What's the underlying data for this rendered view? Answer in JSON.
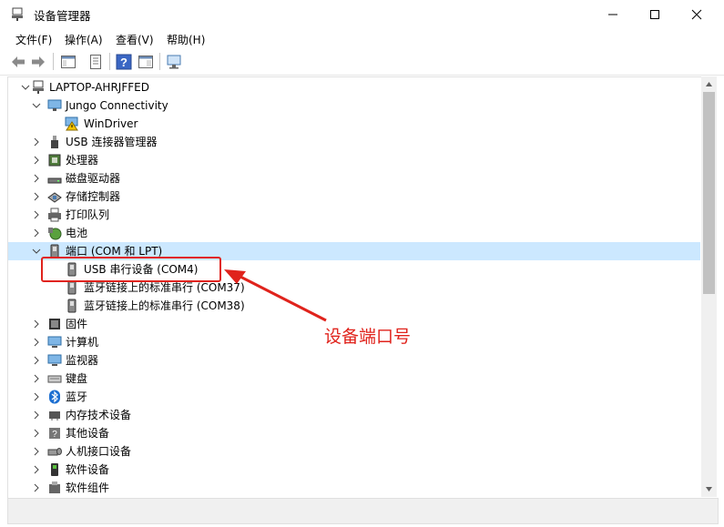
{
  "window": {
    "title": "设备管理器"
  },
  "menu": [
    "文件(F)",
    "操作(A)",
    "查看(V)",
    "帮助(H)"
  ],
  "toolbar": [
    "back-icon",
    "forward-icon",
    "show-hide-tree-icon",
    "properties-icon",
    "help-icon",
    "action-pane-icon",
    "scan-hardware-icon"
  ],
  "tree": {
    "root": "LAPTOP-AHRJFFED",
    "items": [
      {
        "label": "Jungo Connectivity",
        "expanded": true,
        "children": [
          {
            "label": "WinDriver"
          }
        ]
      },
      {
        "label": "USB 连接器管理器"
      },
      {
        "label": "处理器"
      },
      {
        "label": "磁盘驱动器"
      },
      {
        "label": "存储控制器"
      },
      {
        "label": "打印队列"
      },
      {
        "label": "电池"
      },
      {
        "label": "端口 (COM 和 LPT)",
        "expanded": true,
        "children": [
          {
            "label": "USB 串行设备 (COM4)"
          },
          {
            "label": "蓝牙链接上的标准串行 (COM37)"
          },
          {
            "label": "蓝牙链接上的标准串行 (COM38)"
          }
        ]
      },
      {
        "label": "固件"
      },
      {
        "label": "计算机"
      },
      {
        "label": "监视器"
      },
      {
        "label": "键盘"
      },
      {
        "label": "蓝牙"
      },
      {
        "label": "内存技术设备"
      },
      {
        "label": "其他设备"
      },
      {
        "label": "人机接口设备"
      },
      {
        "label": "软件设备"
      },
      {
        "label": "软件组件"
      }
    ]
  },
  "annotation": {
    "text": "设备端口号",
    "color": "#e0231c"
  }
}
